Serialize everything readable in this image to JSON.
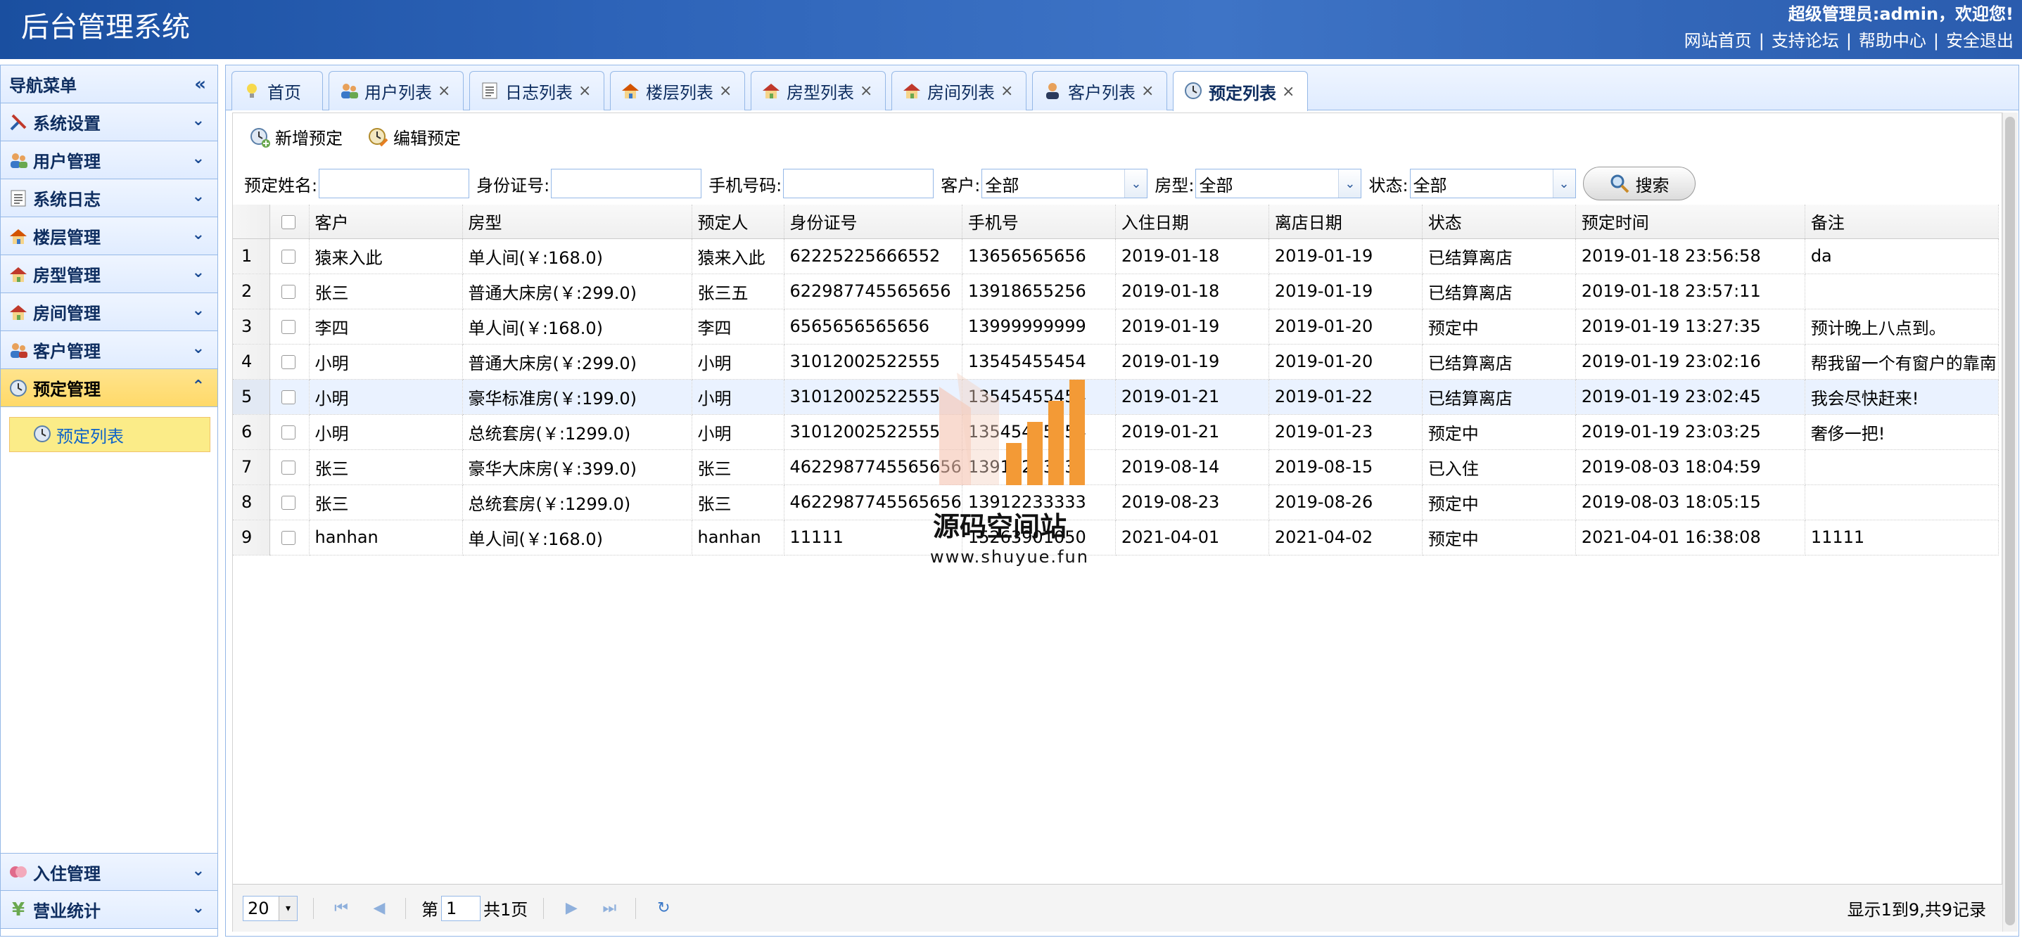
{
  "header": {
    "title": "后台管理系统",
    "welcome": "超级管理员:admin，欢迎您!",
    "links": [
      "网站首页",
      "支持论坛",
      "帮助中心",
      "安全退出"
    ],
    "separator": "|"
  },
  "sidebar": {
    "title": "导航菜单",
    "items": [
      {
        "label": "系统设置",
        "icon": "tools-icon"
      },
      {
        "label": "用户管理",
        "icon": "users-icon"
      },
      {
        "label": "系统日志",
        "icon": "log-icon"
      },
      {
        "label": "楼层管理",
        "icon": "building-icon"
      },
      {
        "label": "房型管理",
        "icon": "house-icon"
      },
      {
        "label": "房间管理",
        "icon": "room-icon"
      },
      {
        "label": "客户管理",
        "icon": "customer-icon"
      },
      {
        "label": "预定管理",
        "icon": "clock-icon"
      }
    ],
    "sub_item": "预定列表",
    "bottom_items": [
      {
        "label": "入住管理",
        "icon": "checkin-icon"
      },
      {
        "label": "营业统计",
        "icon": "yen-icon"
      }
    ]
  },
  "tabs": [
    {
      "label": "首页",
      "closable": false
    },
    {
      "label": "用户列表",
      "closable": true
    },
    {
      "label": "日志列表",
      "closable": true
    },
    {
      "label": "楼层列表",
      "closable": true
    },
    {
      "label": "房型列表",
      "closable": true
    },
    {
      "label": "房间列表",
      "closable": true
    },
    {
      "label": "客户列表",
      "closable": true
    },
    {
      "label": "预定列表",
      "closable": true
    }
  ],
  "toolbar": {
    "add": "新增预定",
    "edit": "编辑预定"
  },
  "search": {
    "name_label": "预定姓名:",
    "id_label": "身份证号:",
    "phone_label": "手机号码:",
    "customer_label": "客户:",
    "customer_value": "全部",
    "roomtype_label": "房型:",
    "roomtype_value": "全部",
    "status_label": "状态:",
    "status_value": "全部",
    "button": "搜索"
  },
  "table": {
    "columns": [
      "客户",
      "房型",
      "预定人",
      "身份证号",
      "手机号",
      "入住日期",
      "离店日期",
      "状态",
      "预定时间",
      "备注"
    ],
    "rows": [
      [
        "1",
        "猿来入此",
        "单人间(￥:168.0)",
        "猿来入此",
        "62225225666552",
        "13656565656",
        "2019-01-18",
        "2019-01-19",
        "已结算离店",
        "2019-01-18 23:56:58",
        "da"
      ],
      [
        "2",
        "张三",
        "普通大床房(￥:299.0)",
        "张三五",
        "622987745565656",
        "13918655256",
        "2019-01-18",
        "2019-01-19",
        "已结算离店",
        "2019-01-18 23:57:11",
        ""
      ],
      [
        "3",
        "李四",
        "单人间(￥:168.0)",
        "李四",
        "6565656565656",
        "13999999999",
        "2019-01-19",
        "2019-01-20",
        "预定中",
        "2019-01-19 13:27:35",
        "预计晚上八点到。"
      ],
      [
        "4",
        "小明",
        "普通大床房(￥:299.0)",
        "小明",
        "31012002522555",
        "13545455454",
        "2019-01-19",
        "2019-01-20",
        "已结算离店",
        "2019-01-19 23:02:16",
        "帮我留一个有窗户的靠南"
      ],
      [
        "5",
        "小明",
        "豪华标准房(￥:199.0)",
        "小明",
        "31012002522555",
        "13545455454",
        "2019-01-21",
        "2019-01-22",
        "已结算离店",
        "2019-01-19 23:02:45",
        "我会尽快赶来!"
      ],
      [
        "6",
        "小明",
        "总统套房(￥:1299.0)",
        "小明",
        "31012002522555",
        "13545455454",
        "2019-01-21",
        "2019-01-23",
        "预定中",
        "2019-01-19 23:03:25",
        "奢侈一把!"
      ],
      [
        "7",
        "张三",
        "豪华大床房(￥:399.0)",
        "张三",
        "4622987745565656",
        "13912233333",
        "2019-08-14",
        "2019-08-15",
        "已入住",
        "2019-08-03 18:04:59",
        ""
      ],
      [
        "8",
        "张三",
        "总统套房(￥:1299.0)",
        "张三",
        "4622987745565656",
        "13912233333",
        "2019-08-23",
        "2019-08-26",
        "预定中",
        "2019-08-03 18:05:15",
        ""
      ],
      [
        "9",
        "hanhan",
        "单人间(￥:168.0)",
        "hanhan",
        "11111",
        "15263901050",
        "2021-04-01",
        "2021-04-02",
        "预定中",
        "2021-04-01 16:38:08",
        "11111"
      ]
    ]
  },
  "pager": {
    "page_size": "20",
    "page_prefix": "第",
    "page": "1",
    "page_total": "共1页",
    "info": "显示1到9,共9记录"
  },
  "watermark": {
    "text": "源码空间站",
    "url": "www.shuyue.fun"
  },
  "colors": {
    "header": "#2d63b8",
    "active_nav": "#ffd969",
    "border": "#95b8e7",
    "link": "#0e63c8"
  }
}
